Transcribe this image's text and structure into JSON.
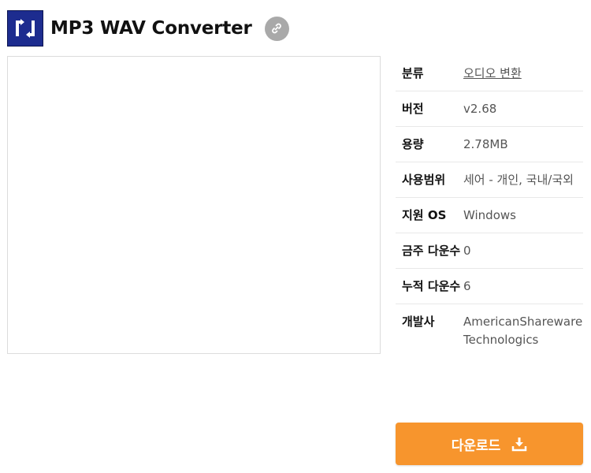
{
  "app": {
    "title": "MP3 WAV Converter",
    "logo_icon": "arrows-cycle-icon",
    "link_icon": "link-icon"
  },
  "info": {
    "rows": [
      {
        "label": "분류",
        "value": "오디오 변환",
        "is_link": true
      },
      {
        "label": "버전",
        "value": "v2.68"
      },
      {
        "label": "용량",
        "value": "2.78MB"
      },
      {
        "label": "사용범위",
        "value": "세어 - 개인, 국내/국외"
      },
      {
        "label": "지원 OS",
        "value": "Windows"
      },
      {
        "label": "금주 다운수",
        "value": "0"
      },
      {
        "label": "누적 다운수",
        "value": "6"
      },
      {
        "label": "개발사",
        "value": "AmericanShareware Technologics"
      }
    ]
  },
  "download": {
    "label": "다운로드",
    "icon": "download-icon"
  },
  "colors": {
    "accent": "#f7952d",
    "logo_bg": "#1d2c8f",
    "link_button": "#a9a9a9"
  }
}
